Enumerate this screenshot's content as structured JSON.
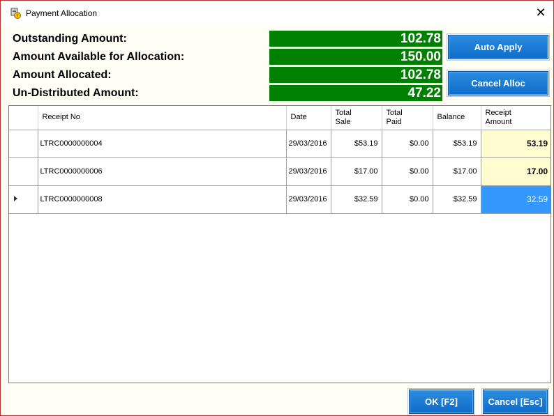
{
  "window": {
    "title": "Payment Allocation",
    "close_glyph": "✕"
  },
  "summary": [
    {
      "label": "Outstanding Amount:",
      "value": "102.78"
    },
    {
      "label": "Amount Available for Allocation:",
      "value": "150.00"
    },
    {
      "label": "Amount Allocated:",
      "value": "102.78"
    },
    {
      "label": "Un-Distributed Amount:",
      "value": "47.22"
    }
  ],
  "buttons": {
    "auto_apply": "Auto Apply",
    "cancel_alloc": "Cancel Alloc",
    "ok": "OK [F2]",
    "cancel": "Cancel [Esc]"
  },
  "table": {
    "headers": {
      "receipt_no": "Receipt No",
      "date": "Date",
      "total_sale_1": "Total",
      "total_sale_2": "Sale",
      "total_paid_1": "Total",
      "total_paid_2": "Paid",
      "balance": "Balance",
      "receipt_amount_1": "Receipt",
      "receipt_amount_2": "Amount"
    },
    "rows": [
      {
        "receipt_no": "LTRC0000000004",
        "date": "29/03/2016",
        "total_sale": "$53.19",
        "total_paid": "$0.00",
        "balance": "$53.19",
        "receipt_amount": "53.19"
      },
      {
        "receipt_no": "LTRC0000000006",
        "date": "29/03/2016",
        "total_sale": "$17.00",
        "total_paid": "$0.00",
        "balance": "$17.00",
        "receipt_amount": "17.00"
      },
      {
        "receipt_no": "LTRC0000000008",
        "date": "29/03/2016",
        "total_sale": "$32.59",
        "total_paid": "$0.00",
        "balance": "$32.59",
        "receipt_amount": "32.59"
      }
    ],
    "current_row_index": 2
  },
  "colors": {
    "value_box_bg": "#008000",
    "button_blue": "#1577d2",
    "amount_cell_bg": "#fffdd0",
    "selected_cell_bg": "#3399ff",
    "window_bg": "#fffef4"
  },
  "icons": {
    "app": "payment-app-icon",
    "row_pointer": "row-pointer-icon"
  }
}
